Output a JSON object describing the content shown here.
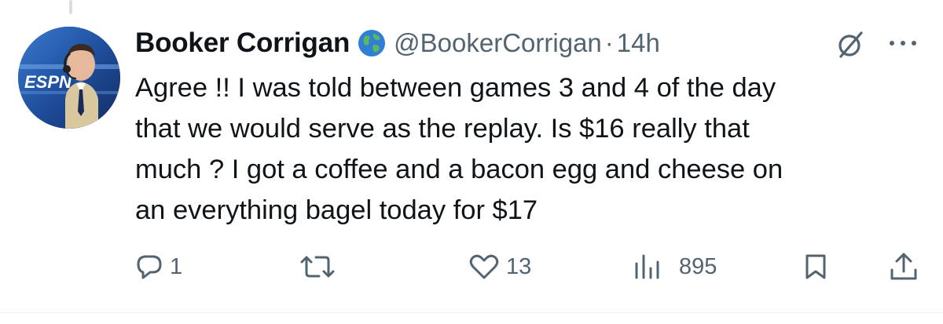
{
  "author": {
    "display_name": "Booker Corrigan",
    "handle": "@BookerCorrigan",
    "separator": "·",
    "timestamp": "14h",
    "badge_icon": "globe-icon",
    "avatar_text": "ESPN"
  },
  "tweet": {
    "lines": [
      "Agree !! I was told between games 3 and 4 of the day",
      "that we would serve as the replay. Is $16 really that",
      "much ? I got a coffee and a bacon egg and cheese on",
      "an everything bagel today for $17"
    ]
  },
  "actions": {
    "reply": {
      "icon": "reply-icon",
      "count": "1"
    },
    "repost": {
      "icon": "repost-icon",
      "count": ""
    },
    "like": {
      "icon": "heart-icon",
      "count": "13"
    },
    "views": {
      "icon": "views-icon",
      "count": "895"
    },
    "bookmark": {
      "icon": "bookmark-icon"
    },
    "share": {
      "icon": "share-icon"
    }
  },
  "colors": {
    "text": "#0f1419",
    "secondary": "#536471",
    "avatar_bg": "#1c3f8a"
  }
}
